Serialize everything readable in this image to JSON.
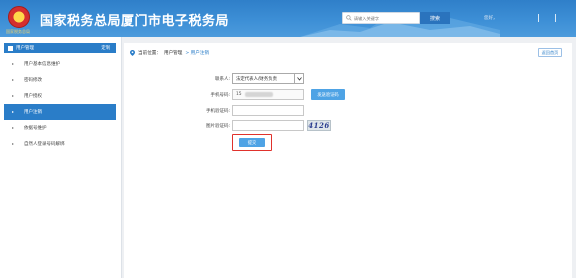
{
  "header": {
    "logo_caption": "国家税务总局",
    "title": "国家税务总局厦门市电子税务局",
    "search_placeholder": "请输入关键字",
    "search_button": "搜索",
    "welcome": "您好，",
    "bg_color": "#3d8fd6"
  },
  "sidebar": {
    "header_label": "用户管理",
    "header_right": "定制",
    "items": [
      {
        "label": "用户基本信息维护",
        "active": false
      },
      {
        "label": "密码修改",
        "active": false
      },
      {
        "label": "用户授权",
        "active": false
      },
      {
        "label": "用户注销",
        "active": true
      },
      {
        "label": "依据号维护",
        "active": false
      },
      {
        "label": "自然人登录号码解绑",
        "active": false
      }
    ],
    "accent": "#2a7dc8"
  },
  "main": {
    "breadcrumb": {
      "prefix": "当前位置：",
      "section": "用户管理",
      "current": "> 用户注销"
    },
    "return_button": "返回首页",
    "form": {
      "contact_label": "联系人:",
      "contact_value": "法定代表人/财务负责",
      "phone_label": "手机号码:",
      "phone_value": "15",
      "send_code_button": "发送验证码",
      "sms_code_label": "手机验证码:",
      "captcha_label": "图片验证码:",
      "captcha_text": "4126",
      "submit_button": "提交"
    }
  }
}
